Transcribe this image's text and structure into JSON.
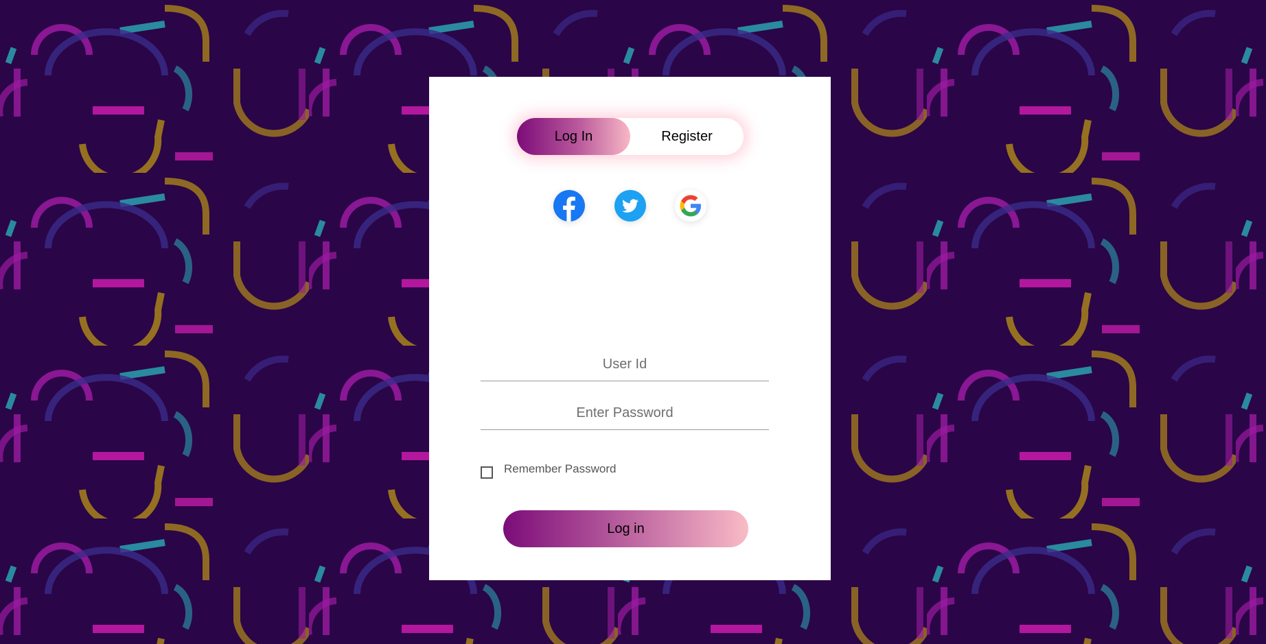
{
  "theme": {
    "background": "#2a0547",
    "card_background": "#ffffff",
    "gradient_start": "#7c0c79",
    "gradient_end": "#f9bcc6",
    "pattern_colors": [
      "#9b1aa0",
      "#2a8aa0",
      "#a8821a",
      "#c21aa8",
      "#3a2a8a"
    ]
  },
  "toggle": {
    "login_label": "Log In",
    "register_label": "Register",
    "active": "login"
  },
  "social": [
    {
      "name": "facebook",
      "icon": "facebook-icon",
      "color": "#1877f2"
    },
    {
      "name": "twitter",
      "icon": "twitter-icon",
      "color": "#1da1f2"
    },
    {
      "name": "google",
      "icon": "google-icon",
      "color": "#4285f4"
    }
  ],
  "form": {
    "user_id_placeholder": "User Id",
    "password_placeholder": "Enter Password",
    "remember_label": "Remember Password",
    "remember_checked": false,
    "submit_label": "Log in"
  }
}
